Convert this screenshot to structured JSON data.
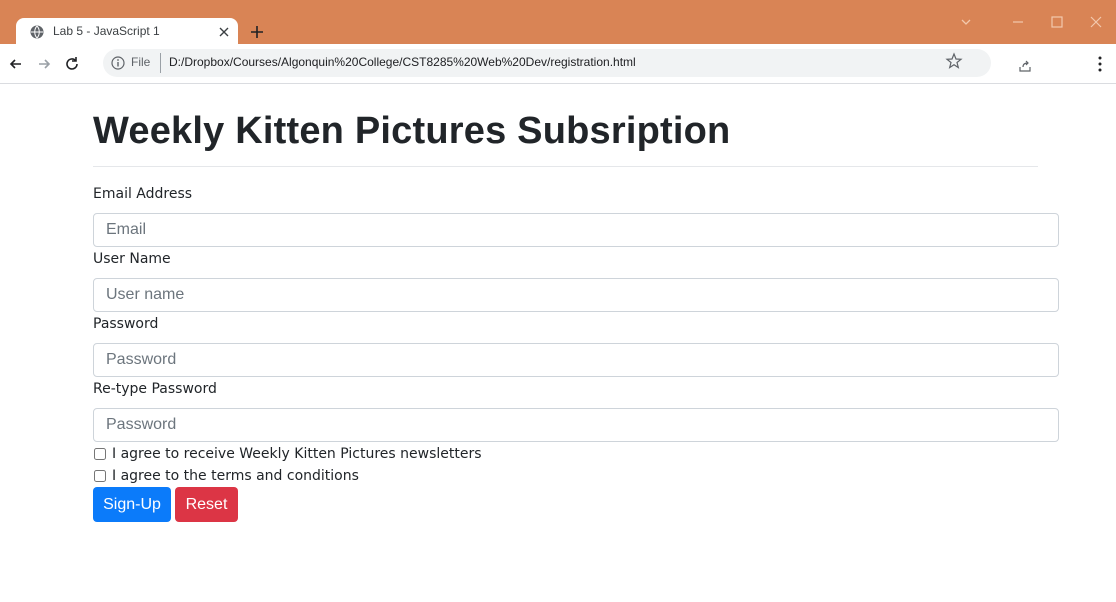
{
  "browser": {
    "tab_title": "Lab 5 - JavaScript 1",
    "address": {
      "scheme_label": "File",
      "url": "D:/Dropbox/Courses/Algonquin%20College/CST8285%20Web%20Dev/registration.html"
    },
    "colors": {
      "frame": "#d98455"
    }
  },
  "page": {
    "title": "Weekly Kitten Pictures Subsription",
    "form": {
      "email": {
        "label": "Email Address",
        "placeholder": "Email",
        "value": ""
      },
      "username": {
        "label": "User Name",
        "placeholder": "User name",
        "value": ""
      },
      "password": {
        "label": "Password",
        "placeholder": "Password",
        "value": ""
      },
      "retype_password": {
        "label": "Re-type Password",
        "placeholder": "Password",
        "value": ""
      },
      "newsletter_checkbox": {
        "label": "I agree to receive Weekly Kitten Pictures newsletters",
        "checked": false
      },
      "terms_checkbox": {
        "label": "I agree to the terms and conditions",
        "checked": false
      },
      "signup_button": "Sign-Up",
      "reset_button": "Reset"
    },
    "colors": {
      "primary": "#0b7bfa",
      "danger": "#dc3545"
    }
  }
}
